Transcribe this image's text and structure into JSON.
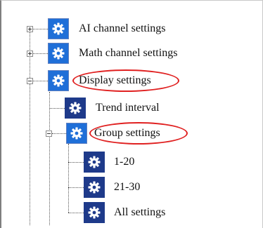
{
  "tree": {
    "nodes": [
      {
        "label": "AI channel settings",
        "state": "collapsed",
        "icon": "gear-icon",
        "icon_color": "#1f6fd8"
      },
      {
        "label": "Math channel settings",
        "state": "collapsed",
        "icon": "gear-icon",
        "icon_color": "#1f6fd8"
      },
      {
        "label": "Display settings",
        "state": "expanded",
        "icon": "gear-icon",
        "icon_color": "#1f6fd8",
        "highlighted": true,
        "children": [
          {
            "label": "Trend interval",
            "icon": "gear-icon",
            "icon_color": "#1e3a8a"
          },
          {
            "label": "Group settings",
            "state": "expanded",
            "icon": "gear-icon",
            "icon_color": "#1f6fd8",
            "highlighted": true,
            "children": [
              {
                "label": "1-20",
                "icon": "gear-icon",
                "icon_color": "#1e3a8a"
              },
              {
                "label": "21-30",
                "icon": "gear-icon",
                "icon_color": "#1e3a8a"
              },
              {
                "label": "All settings",
                "icon": "gear-icon",
                "icon_color": "#1e3a8a"
              }
            ]
          }
        ]
      }
    ]
  },
  "highlight_color": "#e02020"
}
